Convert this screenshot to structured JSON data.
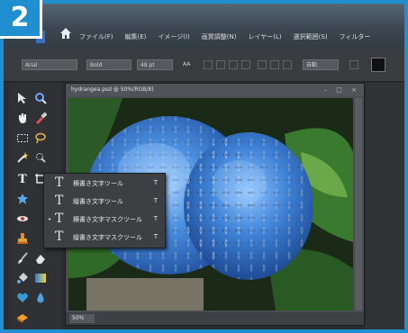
{
  "badge": {
    "step": "2"
  },
  "menu": [
    "ファイル(F)",
    "編集(E)",
    "イメージ(I)",
    "画質調整(N)",
    "レイヤー(L)",
    "選択範囲(S)",
    "フィルター"
  ],
  "options": {
    "font": "Arial",
    "style": "Bold",
    "size": "48 pt",
    "aa": "AA",
    "align_label": "自動"
  },
  "document": {
    "title": "hydrangea.psd @ 50%(RGB/8)",
    "zoom": "50%",
    "controls": "– □ ×"
  },
  "flyout": {
    "items": [
      {
        "check": "",
        "icon": "T",
        "label": "横書き文字ツール",
        "key": "T"
      },
      {
        "check": "",
        "icon": "T",
        "label": "縦書き文字ツール",
        "key": "T"
      },
      {
        "check": "•",
        "icon": "T",
        "label": "横書き文字マスクツール",
        "key": "T"
      },
      {
        "check": "",
        "icon": "T",
        "label": "縦書き文字マスクツール",
        "key": "T"
      }
    ]
  },
  "colors": {
    "accent": "#1f8fd0",
    "hydrangea": "#3d7fd6",
    "leaf": "#2f6b2a"
  }
}
